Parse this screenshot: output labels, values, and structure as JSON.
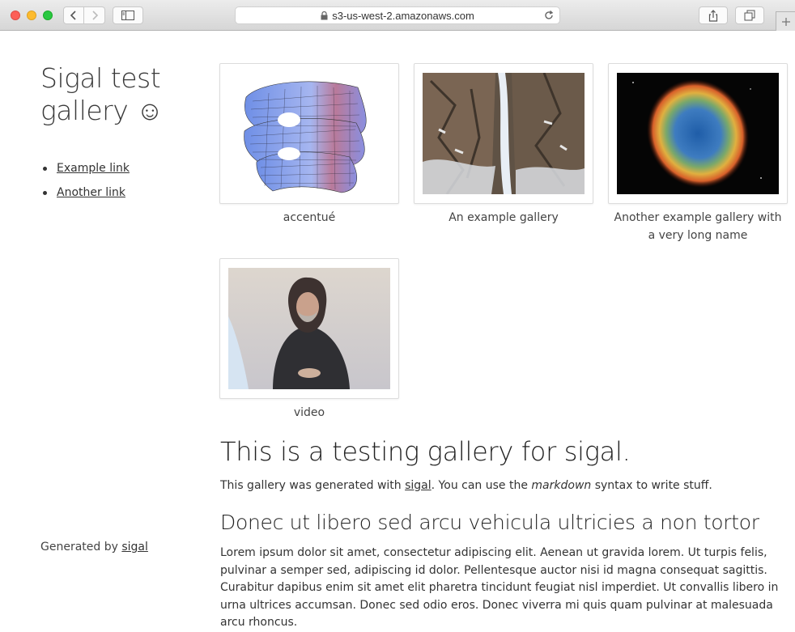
{
  "browser": {
    "url": "s3-us-west-2.amazonaws.com"
  },
  "sidebar": {
    "title": "Sigal test gallery ☺",
    "links": [
      {
        "label": "Example link"
      },
      {
        "label": "Another link"
      }
    ],
    "footer_prefix": "Generated by ",
    "footer_link": "sigal"
  },
  "gallery": {
    "albums": [
      {
        "caption": "accentué"
      },
      {
        "caption": "An example gallery"
      },
      {
        "caption": "Another example gallery with a very long name"
      },
      {
        "caption": "video"
      }
    ]
  },
  "content": {
    "heading": "This is a testing gallery for sigal.",
    "intro_before": "This gallery was generated with ",
    "intro_link": "sigal",
    "intro_middle": ". You can use the ",
    "intro_em": "markdown",
    "intro_after": " syntax to write stuff.",
    "subheading": "Donec ut libero sed arcu vehicula ultricies a non tortor",
    "paragraph": "Lorem ipsum dolor sit amet, consectetur adipiscing elit. Aenean ut gravida lorem. Ut turpis felis, pulvinar a semper sed, adipiscing id dolor. Pellentesque auctor nisi id magna consequat sagittis. Curabitur dapibus enim sit amet elit pharetra tincidunt feugiat nisl imperdiet. Ut convallis libero in urna ultrices accumsan. Donec sed odio eros. Donec viverra mi quis quam pulvinar at malesuada arcu rhoncus."
  }
}
